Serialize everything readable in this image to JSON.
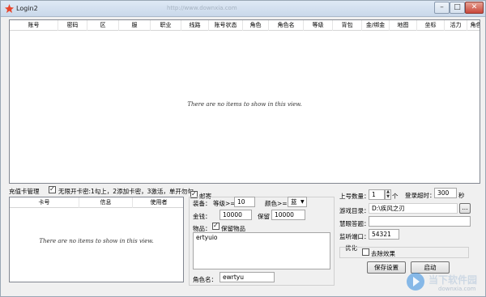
{
  "window": {
    "title": "Login2",
    "watermark_url": "http://www.downxia.com",
    "controls": {
      "minimize": "–",
      "maximize": "□",
      "close": "✕"
    }
  },
  "main_list": {
    "columns": [
      "账号",
      "密码",
      "区",
      "服",
      "职业",
      "线路",
      "账号状态",
      "角色",
      "角色名",
      "等级",
      "背包",
      "金/绑金",
      "地图",
      "坐标",
      "活力",
      "角色状态"
    ],
    "empty_text": "There are no items to show in this view."
  },
  "card_panel": {
    "label": "充值卡管理",
    "option_label": "无限开卡密:1勾上，2添加卡密，3激活，单开勿勾",
    "option_checked": true,
    "columns": [
      "卡号",
      "信息",
      "使用者"
    ],
    "empty_text": "There are no items to show in this view."
  },
  "mail_panel": {
    "mail_label": "邮寄",
    "mail_checked": true,
    "equip_label": "装备：",
    "level_label": "等级>=",
    "level_value": "10",
    "color_label": "颜色>=",
    "color_value": "蓝",
    "gold_label": "金钱：",
    "gold_value": "10000",
    "keep_label": "保留",
    "keep_value": "10000",
    "items_label": "物品：",
    "keep_items_label": "保留物品",
    "keep_items_checked": true,
    "items_text": "ertyuio",
    "role_name_label": "角色名：",
    "role_name_value": "ewrtyu"
  },
  "settings": {
    "login_count_label": "上号数量：",
    "login_count_value": "1",
    "login_count_unit": "个",
    "timeout_label": "登录超时：",
    "timeout_value": "300",
    "timeout_unit": "秒",
    "game_dir_label": "游戏目录：",
    "game_dir_value": "D:\\疾风之刃",
    "browse_label": "...",
    "captcha_label": "慧眼答题：",
    "captcha_value": "",
    "port_label": "监听端口：",
    "port_value": "54321",
    "optimize_label": "优化",
    "remove_effects_label": "去除效果",
    "remove_effects_checked": false,
    "save_button": "保存设置",
    "start_button": "启动"
  },
  "watermark": {
    "name": "当下软件园",
    "site": "downxia.com"
  }
}
